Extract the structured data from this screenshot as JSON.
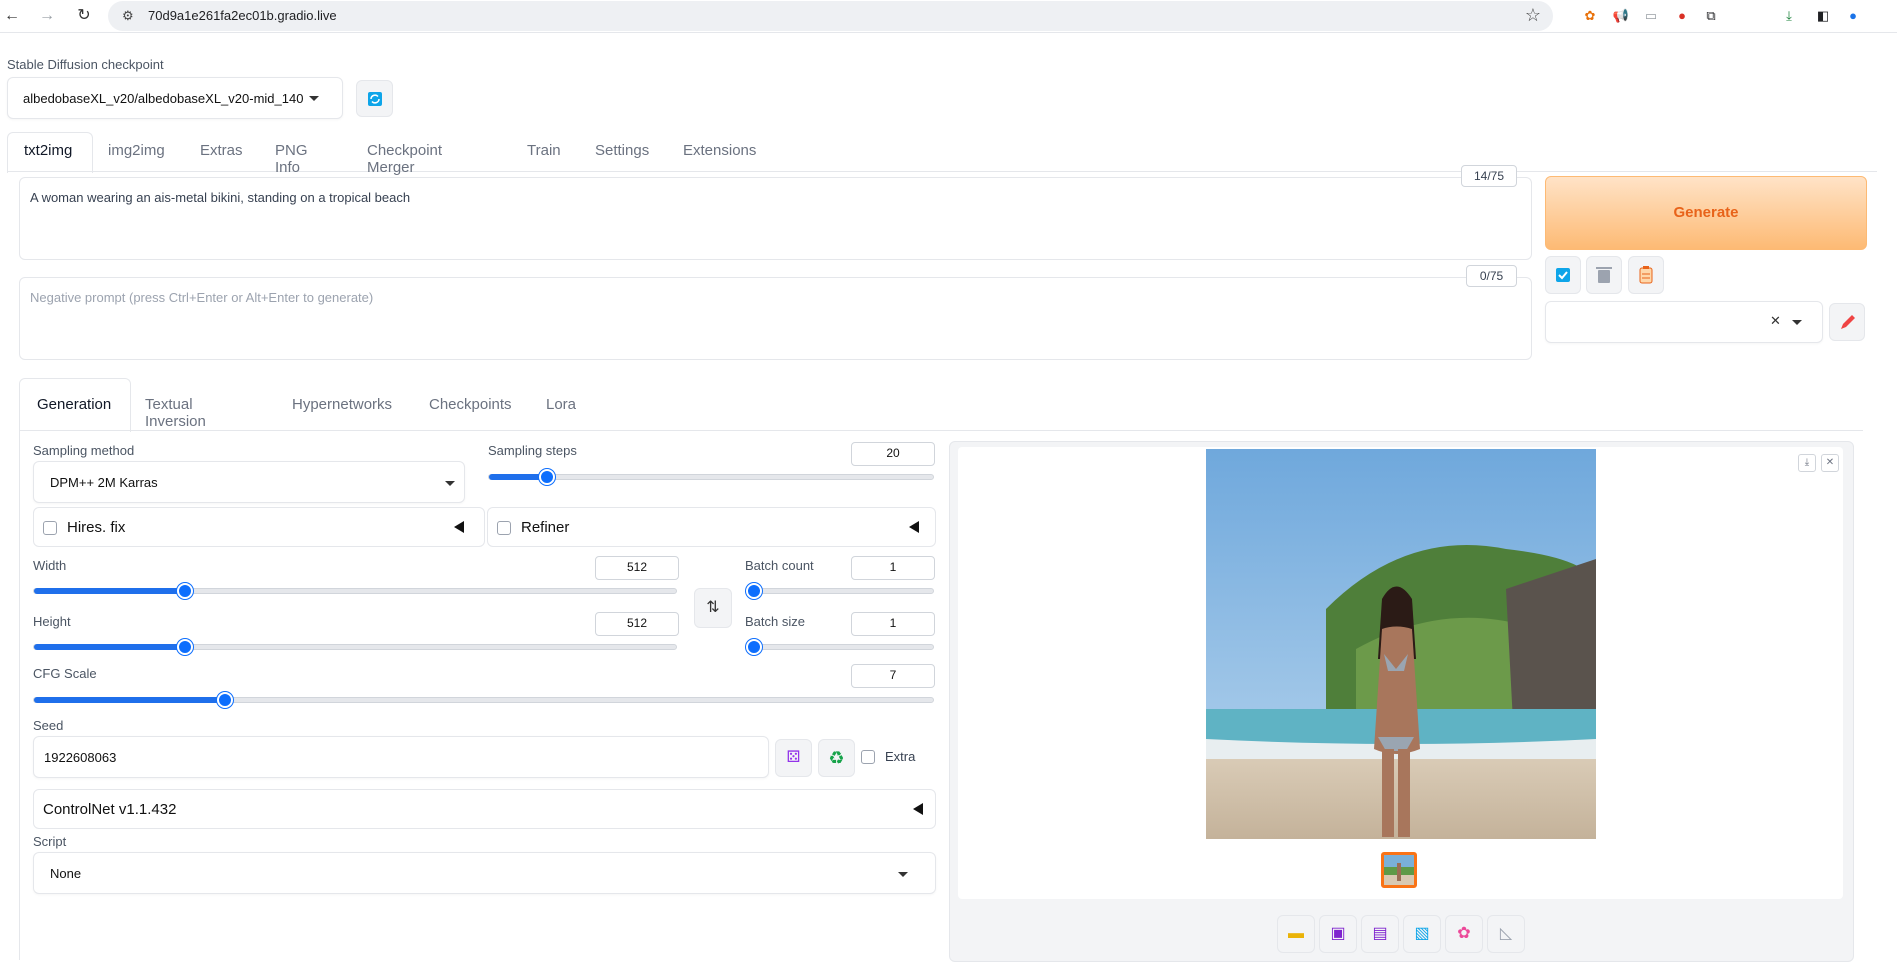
{
  "browser": {
    "url": "70d9a1e261fa2ec01b.gradio.live",
    "back_icon": "←",
    "forward_icon": "→",
    "reload_icon": "↻",
    "site_info_icon": "⚙",
    "star_icon": "☆",
    "extensions": [
      {
        "name": "ext-1",
        "glyph": "✿",
        "color": "#e8710a"
      },
      {
        "name": "ext-2",
        "glyph": "📢",
        "color": "#d93025"
      },
      {
        "name": "ext-3",
        "glyph": "▭",
        "color": "#9aa0a6"
      },
      {
        "name": "ext-4",
        "glyph": "●",
        "color": "#d93025"
      },
      {
        "name": "ext-5",
        "glyph": "⧉",
        "color": "#202124"
      },
      {
        "name": "download",
        "glyph": "⤓",
        "color": "#188038"
      },
      {
        "name": "sidepanel",
        "glyph": "◧",
        "color": "#202124"
      },
      {
        "name": "profile",
        "glyph": "●",
        "color": "#1a73e8"
      }
    ]
  },
  "checkpoint": {
    "label": "Stable Diffusion checkpoint",
    "value": "albedobaseXL_v20/albedobaseXL_v20-mid_140"
  },
  "main_tabs": [
    "txt2img",
    "img2img",
    "Extras",
    "PNG Info",
    "Checkpoint Merger",
    "Train",
    "Settings",
    "Extensions"
  ],
  "prompt": {
    "value": "A woman wearing an ais-metal bikini, standing on a tropical beach",
    "counter": "14/75"
  },
  "negative_prompt": {
    "placeholder": "Negative prompt (press Ctrl+Enter or Alt+Enter to generate)",
    "counter": "0/75"
  },
  "generate_label": "Generate",
  "sub_tabs": [
    "Generation",
    "Textual Inversion",
    "Hypernetworks",
    "Checkpoints",
    "Lora"
  ],
  "sampling_method": {
    "label": "Sampling method",
    "value": "DPM++ 2M Karras"
  },
  "sampling_steps": {
    "label": "Sampling steps",
    "value": "20",
    "fraction": 0.13
  },
  "hires_fix": {
    "label": "Hires. fix"
  },
  "refiner": {
    "label": "Refiner"
  },
  "width": {
    "label": "Width",
    "value": "512",
    "fraction": 0.235
  },
  "height": {
    "label": "Height",
    "value": "512",
    "fraction": 0.235
  },
  "batch_count": {
    "label": "Batch count",
    "value": "1",
    "fraction": 0.0
  },
  "batch_size": {
    "label": "Batch size",
    "value": "1",
    "fraction": 0.0
  },
  "cfg_scale": {
    "label": "CFG Scale",
    "value": "7",
    "fraction": 0.212
  },
  "seed": {
    "label": "Seed",
    "value": "1922608063",
    "extra_label": "Extra"
  },
  "controlnet": {
    "label": "ControlNet v1.1.432"
  },
  "script": {
    "label": "Script",
    "value": "None"
  },
  "colors": {
    "accent": "#0d6efd",
    "generate_text": "#e8631a",
    "thumb_border": "#f97316"
  }
}
